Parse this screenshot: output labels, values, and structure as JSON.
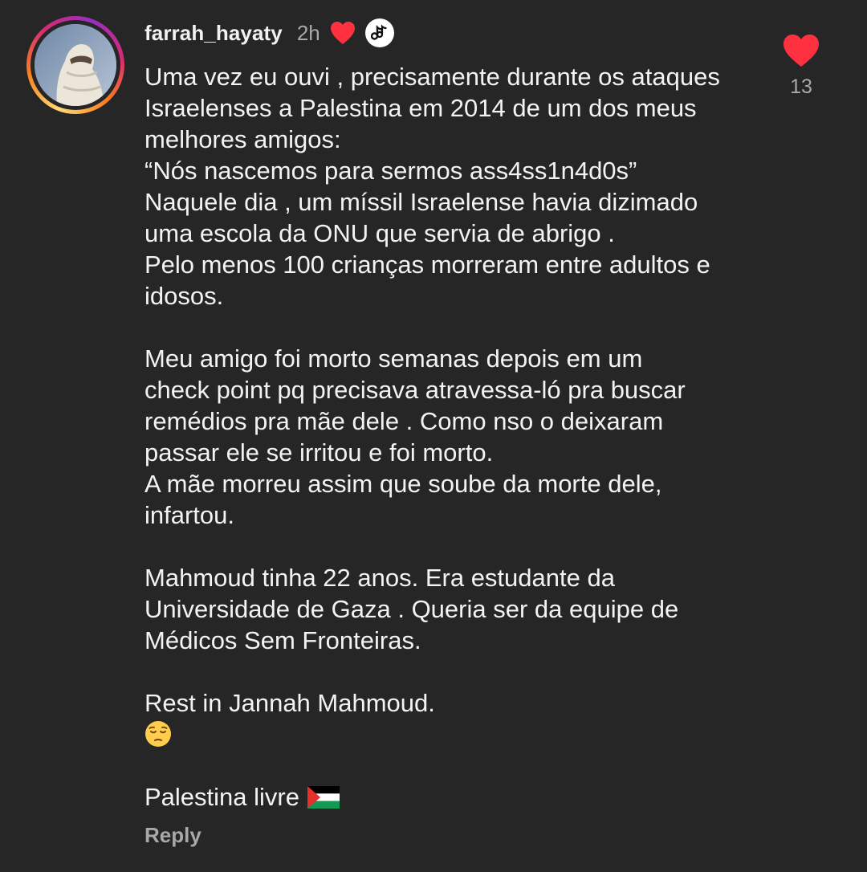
{
  "comment": {
    "username": "farrah_hayaty",
    "time": "2h",
    "creator_liked_icon": "heart-filled-icon",
    "creator_badge_icon": "creator-avatar-icon",
    "like_count": "13",
    "reply_label": "Reply",
    "colors": {
      "background": "#262626",
      "heart": "#ff3040",
      "muted_text": "#a8a8a8",
      "text": "#f3f3f3"
    },
    "text_lines": [
      "Uma vez eu ouvi , precisamente durante os ataques",
      "Israelenses a Palestina em 2014 de um dos meus",
      "melhores amigos:",
      "“Nós nascemos para sermos ass4ss1n4d0s”",
      "Naquele dia , um míssil Israelense havia dizimado",
      "uma escola da ONU que servia de abrigo .",
      "Pelo menos 100 crianças morreram entre adultos e",
      "idosos.",
      "",
      "Meu amigo foi morto semanas depois em um",
      "check point pq precisava atravessa-ló pra buscar",
      "remédios pra mãe dele . Como nso o deixaram",
      "passar ele se irritou e foi morto.",
      "A mãe morreu assim que soube da morte dele,",
      "infartou.",
      "",
      "Mahmoud tinha 22 anos. Era estudante da",
      "Universidade de Gaza . Queria ser da equipe de",
      "Médicos Sem Fronteiras.",
      "",
      "Rest in Jannah Mahmoud."
    ],
    "emoji_line_icon": "pensive-face-emoji",
    "closing_text": "Palestina livre",
    "closing_icon": "palestine-flag-emoji"
  }
}
